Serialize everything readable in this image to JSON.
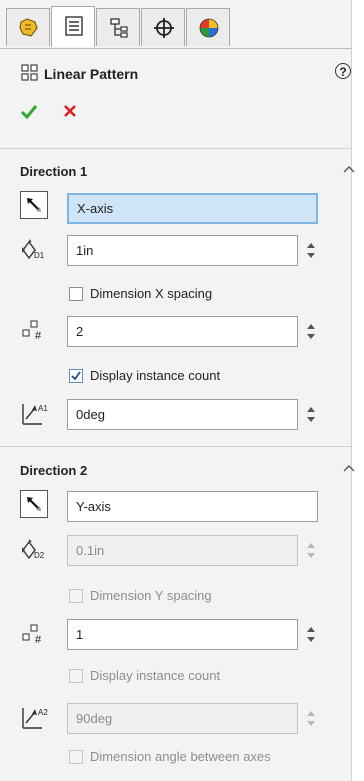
{
  "feature": {
    "title": "Linear Pattern",
    "help_label": "?"
  },
  "tabs": [
    {
      "icon": "feature-manager-icon"
    },
    {
      "icon": "property-manager-icon"
    },
    {
      "icon": "configuration-manager-icon"
    },
    {
      "icon": "dimxpert-manager-icon"
    },
    {
      "icon": "display-manager-icon"
    }
  ],
  "direction1": {
    "title": "Direction 1",
    "direction_ref": "X-axis",
    "spacing": "1in",
    "dimension_spacing_label": "Dimension X spacing",
    "dimension_spacing_checked": false,
    "instances": "2",
    "display_count_label": "Display instance count",
    "display_count_checked": true,
    "angle": "0deg"
  },
  "direction2": {
    "title": "Direction 2",
    "direction_ref": "Y-axis",
    "spacing": "0.1in",
    "dimension_spacing_label": "Dimension Y spacing",
    "dimension_spacing_checked": false,
    "instances": "1",
    "display_count_label": "Display instance count",
    "display_count_checked": false,
    "angle": "90deg",
    "angle_between_label": "Dimension angle between axes",
    "angle_between_checked": false
  },
  "colors": {
    "ok": "#2eaa2e",
    "cancel": "#e02020",
    "selected_field": "#cfe4f6"
  }
}
